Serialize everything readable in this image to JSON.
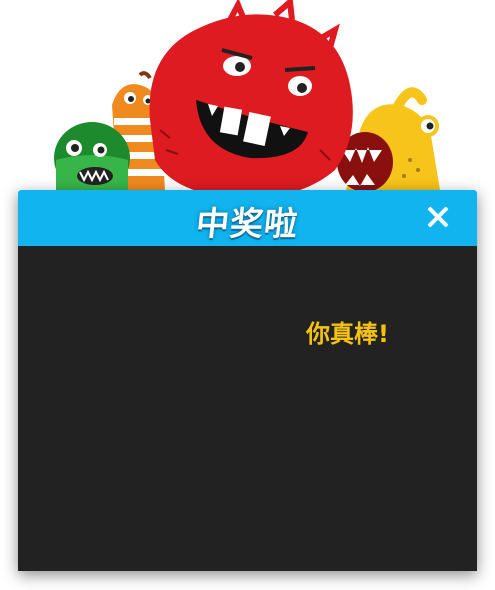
{
  "dialog": {
    "title": "中奖啦",
    "close_icon": "close-x-icon",
    "message": "你真棒!"
  },
  "colors": {
    "header": "#11b4ee",
    "body": "#222222",
    "message": "#f5c211",
    "title": "#ffffff"
  },
  "illustration": {
    "icon": "monsters-illustration"
  }
}
